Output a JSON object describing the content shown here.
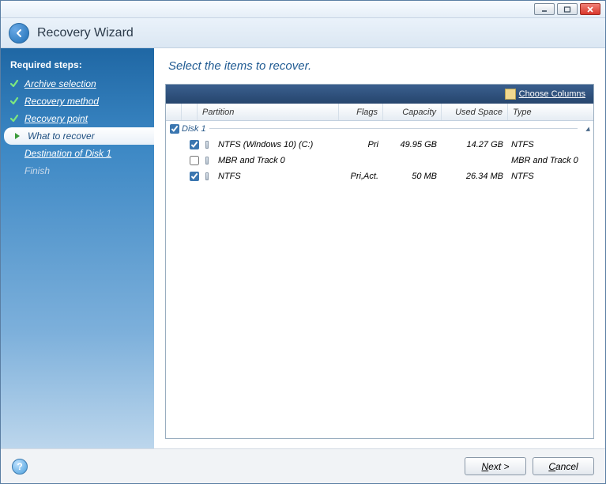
{
  "window": {
    "title": "Recovery Wizard"
  },
  "sidebar": {
    "heading": "Required steps:",
    "steps": [
      {
        "label": "Archive selection",
        "state": "done"
      },
      {
        "label": "Recovery method",
        "state": "done"
      },
      {
        "label": "Recovery point",
        "state": "done"
      },
      {
        "label": "What to recover",
        "state": "current"
      },
      {
        "label": "Destination of Disk 1",
        "state": "upcoming"
      },
      {
        "label": "Finish",
        "state": "disabled"
      }
    ]
  },
  "main": {
    "title": "Select the items to recover.",
    "toolbar": {
      "choose_columns": "Choose Columns"
    },
    "columns": {
      "partition": "Partition",
      "flags": "Flags",
      "capacity": "Capacity",
      "used": "Used Space",
      "type": "Type"
    },
    "group": {
      "label": "Disk 1",
      "checked": true
    },
    "rows": [
      {
        "checked": true,
        "name": "NTFS (Windows 10) (C:)",
        "flags": "Pri",
        "capacity": "49.95 GB",
        "used": "14.27 GB",
        "type": "NTFS"
      },
      {
        "checked": false,
        "name": "MBR and Track 0",
        "flags": "",
        "capacity": "",
        "used": "",
        "type": "MBR and Track 0"
      },
      {
        "checked": true,
        "name": "NTFS",
        "flags": "Pri,Act.",
        "capacity": "50 MB",
        "used": "26.34 MB",
        "type": "NTFS"
      }
    ]
  },
  "footer": {
    "next": "Next >",
    "cancel": "Cancel"
  }
}
